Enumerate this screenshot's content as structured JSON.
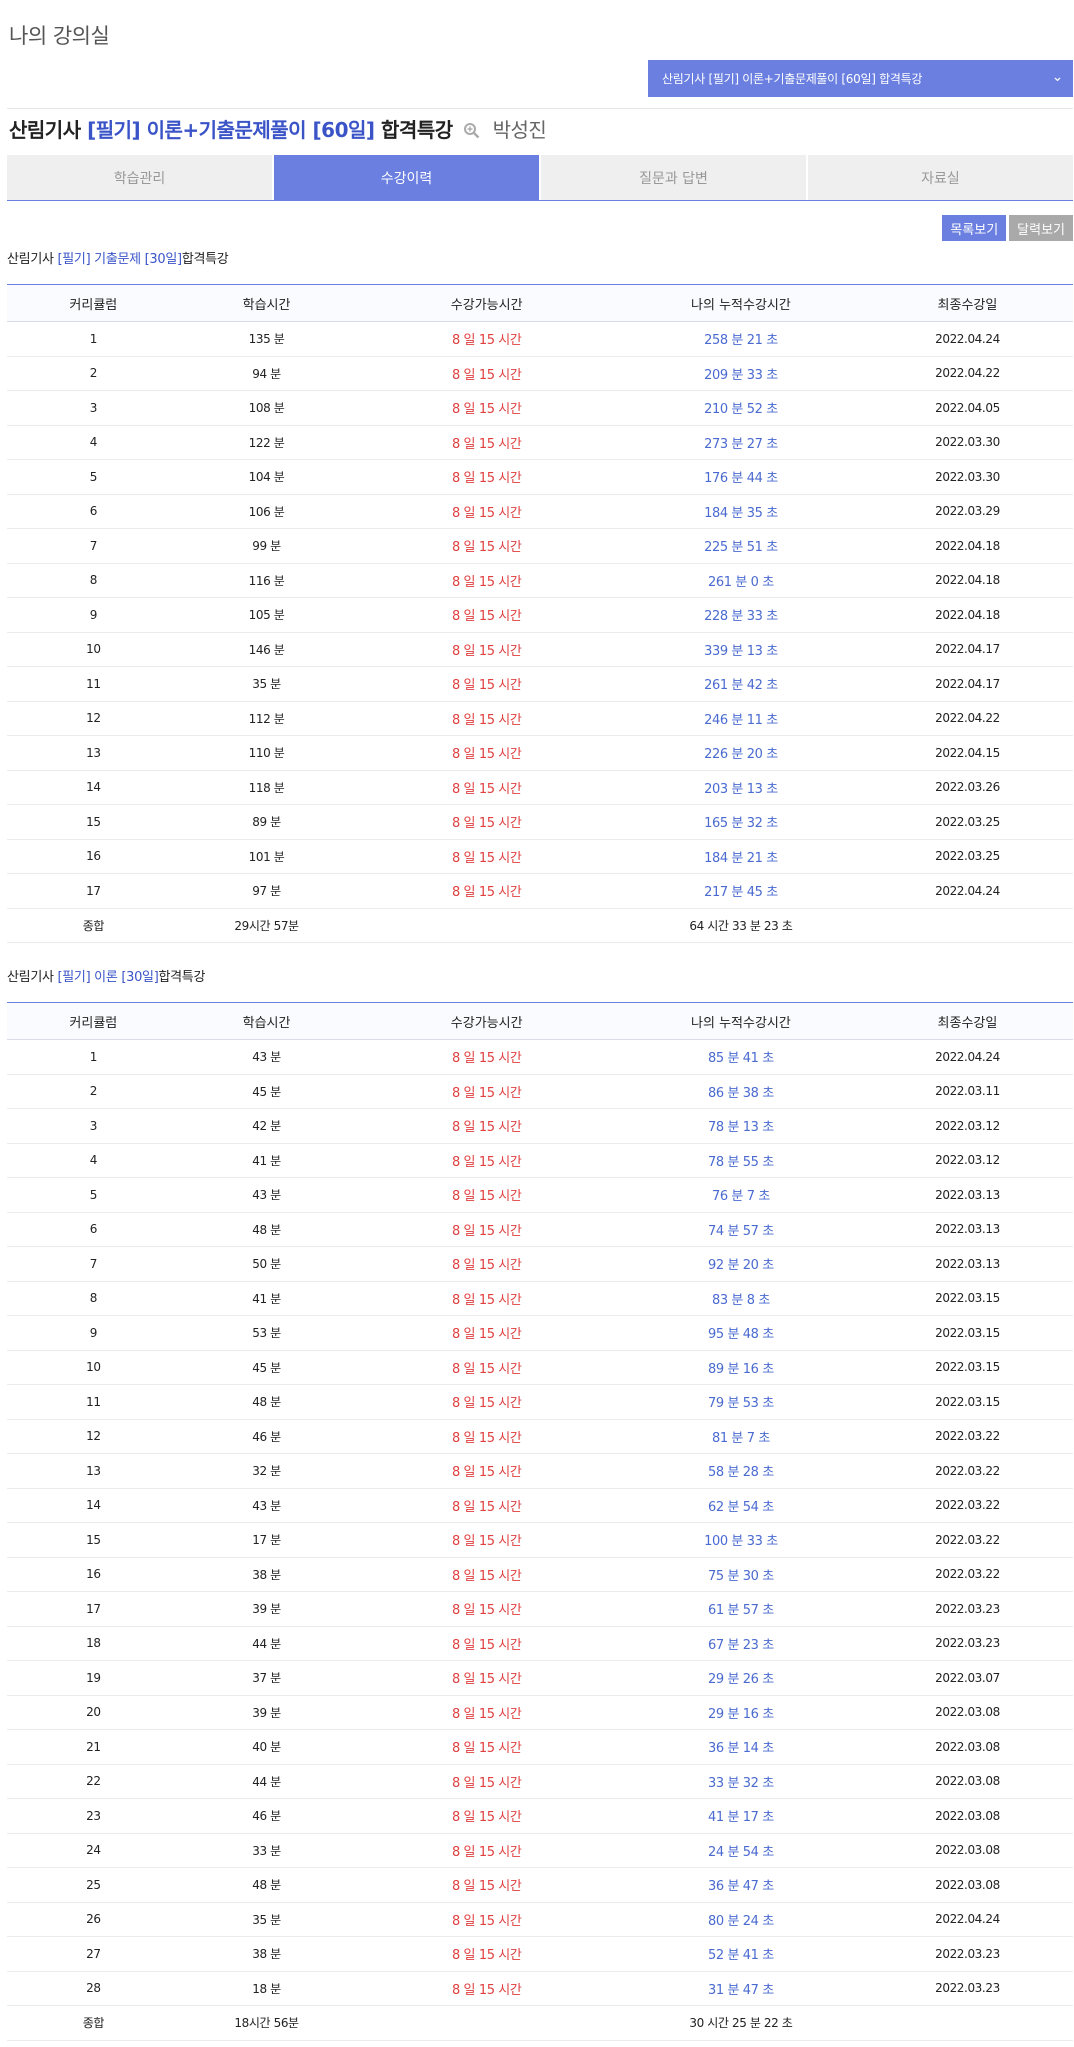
{
  "page": {
    "title": "나의 강의실"
  },
  "course_select": {
    "selected": "산림기사 [필기] 이론+기출문제풀이 [60일] 합격특강"
  },
  "lecture": {
    "prefix": "산림기사",
    "highlight": "[필기] 이론+기출문제풀이 [60일]",
    "suffix": "합격특강",
    "teacher": "박성진"
  },
  "tabs": [
    {
      "label": "학습관리",
      "active": false
    },
    {
      "label": "수강이력",
      "active": true
    },
    {
      "label": "질문과 답변",
      "active": false
    },
    {
      "label": "자료실",
      "active": false
    }
  ],
  "view_buttons": {
    "list": "목록보기",
    "calendar": "달력보기"
  },
  "columns": [
    "커리큘럼",
    "학습시간",
    "수강가능시간",
    "나의 누적수강시간",
    "최종수강일"
  ],
  "colors": {
    "accent": "#6a7fe0",
    "available": "#e04040",
    "accumulated": "#4a6ad0"
  },
  "sections": [
    {
      "prefix": "산림기사",
      "highlight": "[필기] 기출문제 [30일]",
      "suffix": "합격특강",
      "rows": [
        [
          "1",
          "135 분",
          "8 일 15 시간",
          "258 분 21 초",
          "2022.04.24"
        ],
        [
          "2",
          "94 분",
          "8 일 15 시간",
          "209 분 33 초",
          "2022.04.22"
        ],
        [
          "3",
          "108 분",
          "8 일 15 시간",
          "210 분 52 초",
          "2022.04.05"
        ],
        [
          "4",
          "122 분",
          "8 일 15 시간",
          "273 분 27 초",
          "2022.03.30"
        ],
        [
          "5",
          "104 분",
          "8 일 15 시간",
          "176 분 44 초",
          "2022.03.30"
        ],
        [
          "6",
          "106 분",
          "8 일 15 시간",
          "184 분 35 초",
          "2022.03.29"
        ],
        [
          "7",
          "99 분",
          "8 일 15 시간",
          "225 분 51 초",
          "2022.04.18"
        ],
        [
          "8",
          "116 분",
          "8 일 15 시간",
          "261 분 0 초",
          "2022.04.18"
        ],
        [
          "9",
          "105 분",
          "8 일 15 시간",
          "228 분 33 초",
          "2022.04.18"
        ],
        [
          "10",
          "146 분",
          "8 일 15 시간",
          "339 분 13 초",
          "2022.04.17"
        ],
        [
          "11",
          "35 분",
          "8 일 15 시간",
          "261 분 42 초",
          "2022.04.17"
        ],
        [
          "12",
          "112 분",
          "8 일 15 시간",
          "246 분 11 초",
          "2022.04.22"
        ],
        [
          "13",
          "110 분",
          "8 일 15 시간",
          "226 분 20 초",
          "2022.04.15"
        ],
        [
          "14",
          "118 분",
          "8 일 15 시간",
          "203 분 13 초",
          "2022.03.26"
        ],
        [
          "15",
          "89 분",
          "8 일 15 시간",
          "165 분 32 초",
          "2022.03.25"
        ],
        [
          "16",
          "101 분",
          "8 일 15 시간",
          "184 분 21 초",
          "2022.03.25"
        ],
        [
          "17",
          "97 분",
          "8 일 15 시간",
          "217 분 45 초",
          "2022.04.24"
        ]
      ],
      "total": {
        "label": "종합",
        "study": "29시간 57분",
        "accumulated": "64 시간 33 분 23 초"
      }
    },
    {
      "prefix": "산림기사",
      "highlight": "[필기] 이론 [30일]",
      "suffix": "합격특강",
      "rows": [
        [
          "1",
          "43 분",
          "8 일 15 시간",
          "85 분 41 초",
          "2022.04.24"
        ],
        [
          "2",
          "45 분",
          "8 일 15 시간",
          "86 분 38 초",
          "2022.03.11"
        ],
        [
          "3",
          "42 분",
          "8 일 15 시간",
          "78 분 13 초",
          "2022.03.12"
        ],
        [
          "4",
          "41 분",
          "8 일 15 시간",
          "78 분 55 초",
          "2022.03.12"
        ],
        [
          "5",
          "43 분",
          "8 일 15 시간",
          "76 분 7 초",
          "2022.03.13"
        ],
        [
          "6",
          "48 분",
          "8 일 15 시간",
          "74 분 57 초",
          "2022.03.13"
        ],
        [
          "7",
          "50 분",
          "8 일 15 시간",
          "92 분 20 초",
          "2022.03.13"
        ],
        [
          "8",
          "41 분",
          "8 일 15 시간",
          "83 분 8 초",
          "2022.03.15"
        ],
        [
          "9",
          "53 분",
          "8 일 15 시간",
          "95 분 48 초",
          "2022.03.15"
        ],
        [
          "10",
          "45 분",
          "8 일 15 시간",
          "89 분 16 초",
          "2022.03.15"
        ],
        [
          "11",
          "48 분",
          "8 일 15 시간",
          "79 분 53 초",
          "2022.03.15"
        ],
        [
          "12",
          "46 분",
          "8 일 15 시간",
          "81 분 7 초",
          "2022.03.22"
        ],
        [
          "13",
          "32 분",
          "8 일 15 시간",
          "58 분 28 초",
          "2022.03.22"
        ],
        [
          "14",
          "43 분",
          "8 일 15 시간",
          "62 분 54 초",
          "2022.03.22"
        ],
        [
          "15",
          "17 분",
          "8 일 15 시간",
          "100 분 33 초",
          "2022.03.22"
        ],
        [
          "16",
          "38 분",
          "8 일 15 시간",
          "75 분 30 초",
          "2022.03.22"
        ],
        [
          "17",
          "39 분",
          "8 일 15 시간",
          "61 분 57 초",
          "2022.03.23"
        ],
        [
          "18",
          "44 분",
          "8 일 15 시간",
          "67 분 23 초",
          "2022.03.23"
        ],
        [
          "19",
          "37 분",
          "8 일 15 시간",
          "29 분 26 초",
          "2022.03.07"
        ],
        [
          "20",
          "39 분",
          "8 일 15 시간",
          "29 분 16 초",
          "2022.03.08"
        ],
        [
          "21",
          "40 분",
          "8 일 15 시간",
          "36 분 14 초",
          "2022.03.08"
        ],
        [
          "22",
          "44 분",
          "8 일 15 시간",
          "33 분 32 초",
          "2022.03.08"
        ],
        [
          "23",
          "46 분",
          "8 일 15 시간",
          "41 분 17 초",
          "2022.03.08"
        ],
        [
          "24",
          "33 분",
          "8 일 15 시간",
          "24 분 54 초",
          "2022.03.08"
        ],
        [
          "25",
          "48 분",
          "8 일 15 시간",
          "36 분 47 초",
          "2022.03.08"
        ],
        [
          "26",
          "35 분",
          "8 일 15 시간",
          "80 분 24 초",
          "2022.04.24"
        ],
        [
          "27",
          "38 분",
          "8 일 15 시간",
          "52 분 41 초",
          "2022.03.23"
        ],
        [
          "28",
          "18 분",
          "8 일 15 시간",
          "31 분 47 초",
          "2022.03.23"
        ]
      ],
      "total": {
        "label": "종합",
        "study": "18시간 56분",
        "accumulated": "30 시간 25 분 22 초"
      }
    }
  ]
}
